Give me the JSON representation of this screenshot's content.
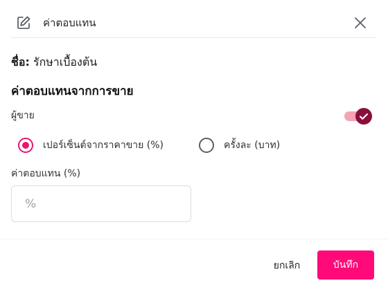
{
  "header": {
    "title": "ค่าตอบแทน",
    "edit_icon": "edit-icon",
    "close_icon": "close-icon"
  },
  "product": {
    "name_label": "ชื่อ:",
    "name_value": "รักษาเบื้องต้น"
  },
  "commission": {
    "section_title": "ค่าตอบแทนจากการขาย",
    "seller_label": "ผู้ขาย",
    "seller_enabled": true,
    "options": [
      {
        "label": "เปอร์เซ็นต์จากราคาขาย (%)",
        "selected": true
      },
      {
        "label": "ครั้งละ (บาท)",
        "selected": false
      }
    ],
    "field_label": "ค่าตอบแทน (%)",
    "field_prefix": "%",
    "field_value": ""
  },
  "footer": {
    "cancel_label": "ยกเลิก",
    "save_label": "บันทึก"
  },
  "colors": {
    "accent": "#ff0a78",
    "radio_selected": "#e8156f",
    "toggle_on": "#8a0f3d",
    "toggle_track": "#f4a3b5"
  }
}
